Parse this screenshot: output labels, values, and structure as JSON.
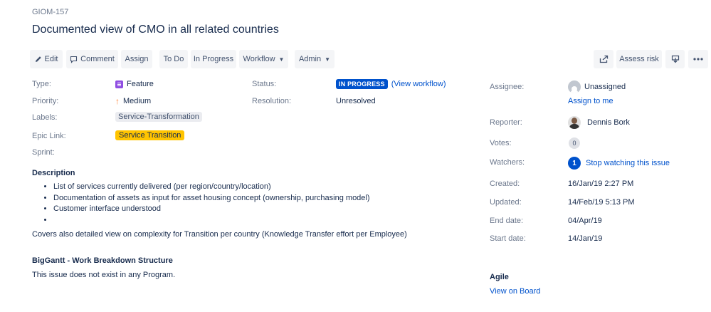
{
  "issue": {
    "key": "GIOM-157",
    "title": "Documented view of CMO in all related countries"
  },
  "toolbar": {
    "edit": "Edit",
    "comment": "Comment",
    "assign": "Assign",
    "todo": "To Do",
    "in_progress": "In Progress",
    "workflow": "Workflow",
    "admin": "Admin",
    "assess_risk": "Assess risk",
    "icons": [
      "pencil-icon",
      "comment-icon",
      "share-icon",
      "export-icon",
      "more-icon"
    ]
  },
  "details": {
    "type_label": "Type:",
    "type_value": "Feature",
    "priority_label": "Priority:",
    "priority_value": "Medium",
    "labels_label": "Labels:",
    "labels_value": "Service-Transformation",
    "epic_label": "Epic Link:",
    "epic_value": "Service Transition",
    "sprint_label": "Sprint:",
    "status_label": "Status:",
    "status_value": "IN PROGRESS",
    "view_workflow": "(View workflow)",
    "resolution_label": "Resolution:",
    "resolution_value": "Unresolved"
  },
  "description": {
    "heading": "Description",
    "bullets": [
      "List of services currently delivered (per region/country/location)",
      "Documentation of assets as input for asset housing concept (ownership, purchasing model)",
      "Customer interface understood",
      ""
    ],
    "paragraph": "Covers also detailed view on complexity for Transition per country (Knowledge Transfer effort per Employee)"
  },
  "biggantt": {
    "heading": "BigGantt - Work Breakdown Structure",
    "text": "This issue does not exist in any Program."
  },
  "people": {
    "assignee_label": "Assignee:",
    "assignee_value": "Unassigned",
    "assign_to_me": "Assign to me",
    "reporter_label": "Reporter:",
    "reporter_value": "Dennis Bork",
    "votes_label": "Votes:",
    "votes_count": "0",
    "watchers_label": "Watchers:",
    "watchers_count": "1",
    "stop_watching": "Stop watching this issue"
  },
  "dates": {
    "created_label": "Created:",
    "created_value": "16/Jan/19 2:27 PM",
    "updated_label": "Updated:",
    "updated_value": "14/Feb/19 5:13 PM",
    "end_label": "End date:",
    "end_value": "04/Apr/19",
    "start_label": "Start date:",
    "start_value": "14/Jan/19"
  },
  "agile": {
    "heading": "Agile",
    "view_on_board": "View on Board"
  },
  "colors": {
    "accent": "#0052cc",
    "status_blue": "#0052cc",
    "epic_yellow": "#ffc400",
    "feature_purple": "#904ee2",
    "priority_orange": "#ff7f30"
  }
}
